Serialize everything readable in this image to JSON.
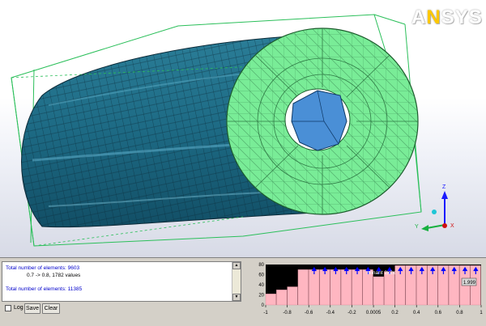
{
  "brand": {
    "prefix": "A",
    "accent": "N",
    "suffix": "SYS"
  },
  "axis_triad": {
    "z": "Z",
    "y": "Y",
    "x": "X"
  },
  "log": {
    "line1": "Total number of elements: 9603",
    "line2": "0.7 -> 0.8, 1782 values",
    "line3": "Total number of elements: 11385"
  },
  "controls": {
    "log_label": "Log",
    "save_label": "Save",
    "clear_label": "Clear",
    "log_checked": false
  },
  "histogram": {
    "title_fragment": "minant 2x2x",
    "value_box": "1.999",
    "y_ticks": [
      "80",
      "60",
      "40",
      "20",
      "0"
    ],
    "x_ticks": [
      "-1",
      "-0.8",
      "-0.6",
      "-0.4",
      "-0.2",
      "0.0005",
      "0.2",
      "0.4",
      "0.6",
      "0.8",
      "1"
    ]
  },
  "chart_data": {
    "type": "bar",
    "title": "",
    "xlim": [
      -1,
      1
    ],
    "ylim": [
      0,
      80
    ],
    "bins": [
      -1.0,
      -0.9,
      -0.8,
      -0.7,
      -0.6,
      -0.5,
      -0.4,
      -0.3,
      -0.2,
      -0.1,
      0.0,
      0.1,
      0.2,
      0.3,
      0.4,
      0.5,
      0.6,
      0.7,
      0.8,
      0.9
    ],
    "values": [
      22,
      30,
      36,
      70,
      70,
      70,
      70,
      70,
      70,
      70,
      56,
      66,
      78,
      78,
      78,
      78,
      78,
      78,
      78,
      78
    ],
    "bar_color": "#ffb6c1",
    "marker_color": "#0000ff"
  },
  "colors": {
    "mesh_blue": "#1f6d86",
    "mesh_green": "#79ec97",
    "bbox": "#2bbf5a",
    "hole": "#4a8fd6"
  }
}
